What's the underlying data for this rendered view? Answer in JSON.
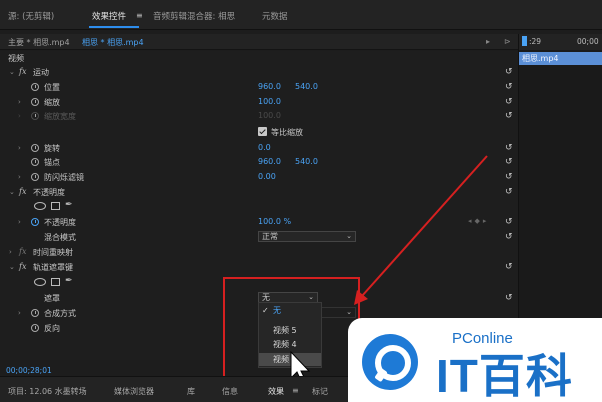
{
  "top_tabs": [
    {
      "label": "源: (无剪辑)"
    },
    {
      "label": "效果控件"
    },
    {
      "label": "音频剪辑混合器: 相思"
    },
    {
      "label": "元数据"
    }
  ],
  "tab_menu_symbol": "≡",
  "breadcrumb": {
    "master": "主要 * 相思.mp4",
    "clip": "相思 * 相思.mp4",
    "nav_arrow": "▸",
    "toggle": "⊳"
  },
  "section_video": "视频",
  "motion": {
    "title": "运动",
    "position_label": "位置",
    "position_x": "960.0",
    "position_y": "540.0",
    "scale_label": "缩放",
    "scale_value": "100.0",
    "scale_width_label": "缩放宽度",
    "scale_width_value": "100.0",
    "uniform_scale_label": "等比缩放",
    "rotation_label": "旋转",
    "rotation_value": "0.0",
    "anchor_label": "锚点",
    "anchor_x": "960.0",
    "anchor_y": "540.0",
    "flicker_label": "防闪烁滤镜",
    "flicker_value": "0.00"
  },
  "opacity": {
    "title": "不透明度",
    "opacity_label": "不透明度",
    "opacity_value": "100.0 %",
    "blend_label": "混合模式",
    "blend_value": "正常"
  },
  "time_remap": {
    "title": "时间重映射"
  },
  "track_matte": {
    "title": "轨道遮罩键",
    "matte_label": "遮罩",
    "matte_value": "无",
    "composite_label": "合成方式",
    "reverse_label": "反向"
  },
  "matte_menu": {
    "items": [
      "无",
      "视频 5",
      "视频 4",
      "视频 3"
    ],
    "selected": "无",
    "check": "✓",
    "visible_hover_text": "视频"
  },
  "timecode": "00;00;28;01",
  "bottom_tabs": [
    {
      "label": "项目: 12.06 水墨转场"
    },
    {
      "label": "媒体浏览器"
    },
    {
      "label": "库"
    },
    {
      "label": "信息"
    },
    {
      "label": "效果"
    },
    {
      "label": "≡"
    },
    {
      "label": "标记"
    }
  ],
  "timeline": {
    "tick_1": ":29",
    "tick_2": "00;00",
    "clip_label": "相思.mp4"
  },
  "watermark": {
    "small": "PConline",
    "big": "IT百科"
  },
  "icons": {
    "reset": "↺",
    "expand": "›",
    "collapse": "⌄",
    "pen": "✒",
    "fx": "fx",
    "kf_nav": "◂◆▸"
  },
  "colors": {
    "accent": "#4aa3f5",
    "highlight_box": "#d62020",
    "clip": "#5b8fd6"
  }
}
